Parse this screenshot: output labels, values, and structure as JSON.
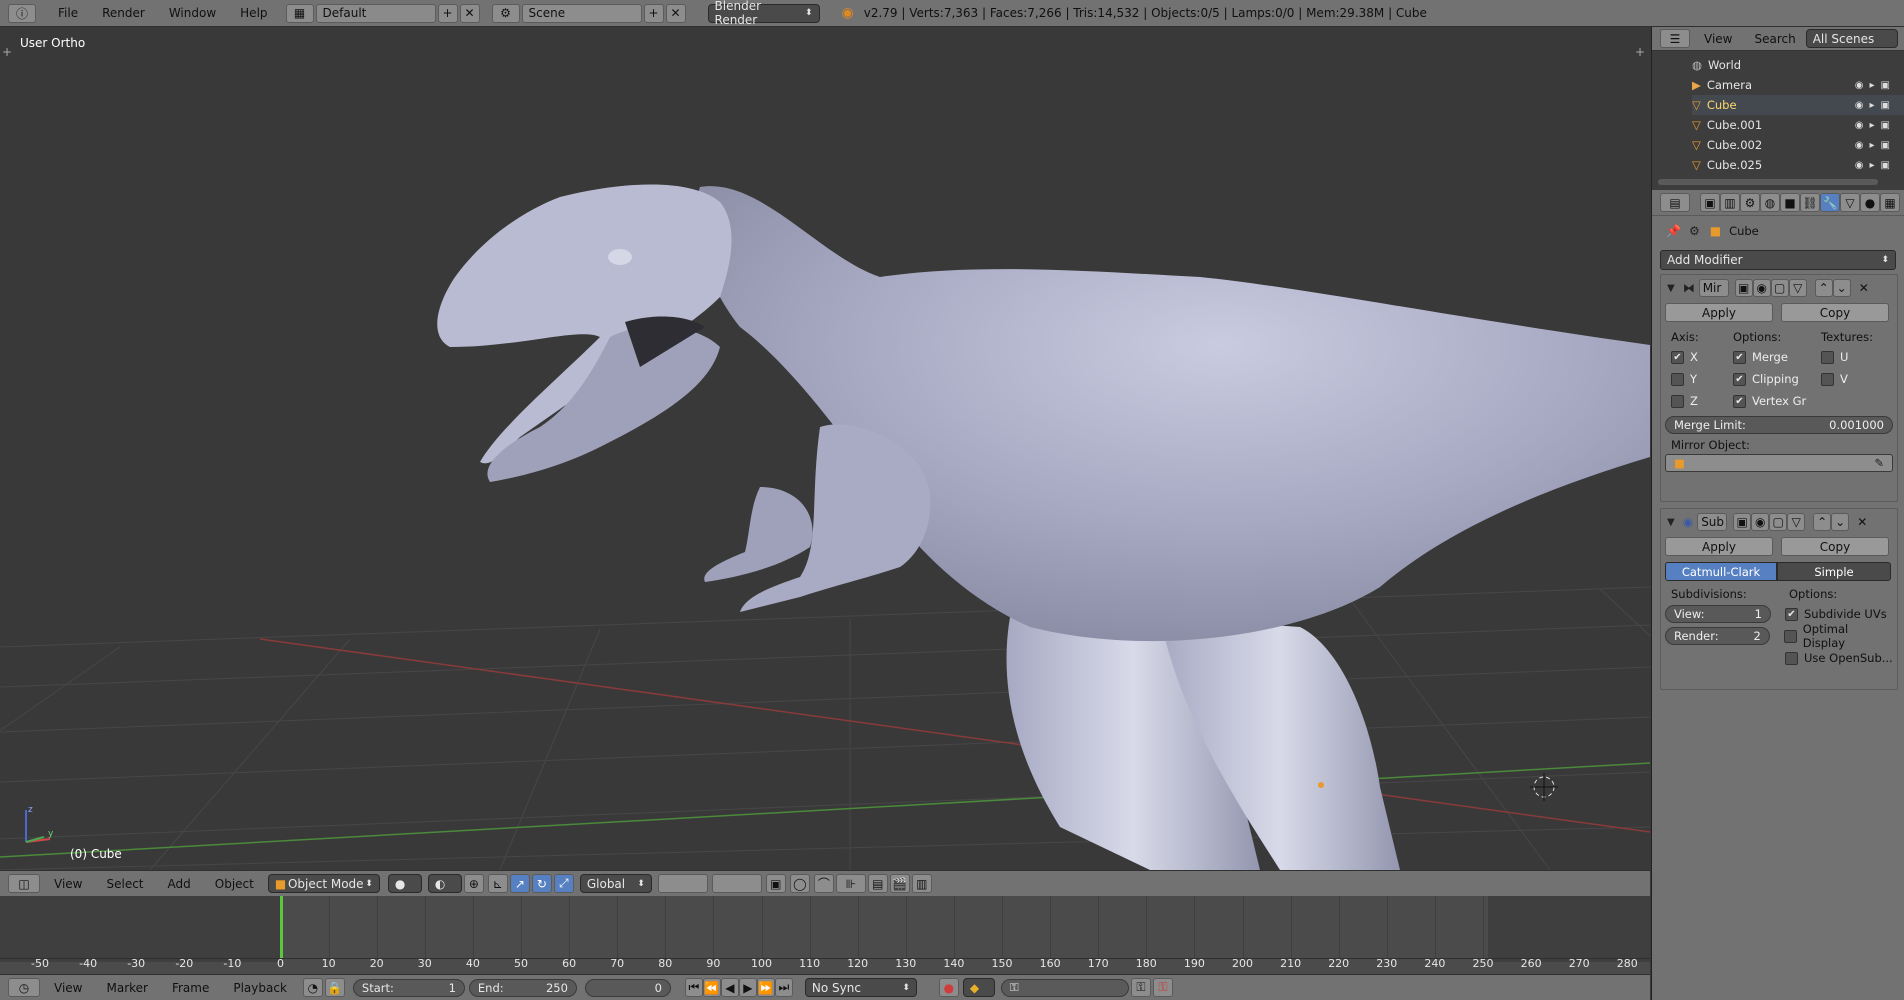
{
  "topbar": {
    "menus": [
      "File",
      "Render",
      "Window",
      "Help"
    ],
    "layout_name": "Default",
    "scene_name": "Scene",
    "render_engine": "Blender Render",
    "stats": "v2.79 | Verts:7,363 | Faces:7,266 | Tris:14,532 | Objects:0/5 | Lamps:0/0 | Mem:29.38M | Cube"
  },
  "viewport": {
    "view_label": "User Ortho",
    "object_label": "(0) Cube",
    "axis_x": "x",
    "axis_y": "y",
    "axis_z": "z"
  },
  "view3d_header": {
    "menus": [
      "View",
      "Select",
      "Add",
      "Object"
    ],
    "mode": "Object Mode",
    "orientation": "Global"
  },
  "timeline": {
    "ticks": [
      "-50",
      "-40",
      "-30",
      "-20",
      "-10",
      "0",
      "10",
      "20",
      "30",
      "40",
      "50",
      "60",
      "70",
      "80",
      "90",
      "100",
      "110",
      "120",
      "130",
      "140",
      "150",
      "160",
      "170",
      "180",
      "190",
      "200",
      "210",
      "220",
      "230",
      "240",
      "250",
      "260",
      "270",
      "280"
    ],
    "current_frame_label": "0",
    "menus": [
      "View",
      "Marker",
      "Frame",
      "Playback"
    ],
    "start_label": "Start:",
    "start_value": "1",
    "end_label": "End:",
    "end_value": "250",
    "frame_value": "0",
    "sync": "No Sync"
  },
  "outliner": {
    "menus": [
      "View",
      "Search"
    ],
    "scope": "All Scenes",
    "items": [
      {
        "name": "World"
      },
      {
        "name": "Camera"
      },
      {
        "name": "Cube"
      },
      {
        "name": "Cube.001"
      },
      {
        "name": "Cube.002"
      },
      {
        "name": "Cube.025"
      }
    ]
  },
  "properties": {
    "context_object": "Cube",
    "add_modifier": "Add Modifier",
    "mirror": {
      "name": "Mir",
      "apply": "Apply",
      "copy": "Copy",
      "axis_label": "Axis:",
      "options_label": "Options:",
      "textures_label": "Textures:",
      "axis": [
        {
          "label": "X",
          "checked": true
        },
        {
          "label": "Y",
          "checked": false
        },
        {
          "label": "Z",
          "checked": false
        }
      ],
      "options": [
        {
          "label": "Merge",
          "checked": true
        },
        {
          "label": "Clipping",
          "checked": true
        },
        {
          "label": "Vertex Gr",
          "checked": true
        }
      ],
      "textures": [
        {
          "label": "U",
          "checked": false
        },
        {
          "label": "V",
          "checked": false
        }
      ],
      "merge_limit_label": "Merge Limit:",
      "merge_limit_value": "0.001000",
      "mirror_object_label": "Mirror Object:"
    },
    "subsurf": {
      "name": "Sub",
      "apply": "Apply",
      "copy": "Copy",
      "type_catmull": "Catmull-Clark",
      "type_simple": "Simple",
      "subdivisions_label": "Subdivisions:",
      "options_label": "Options:",
      "view_label": "View:",
      "view_value": "1",
      "render_label": "Render:",
      "render_value": "2",
      "opt_subdivide_uvs": "Subdivide UVs",
      "opt_optimal_display": "Optimal Display",
      "opt_use_opensubdiv": "Use OpenSub..."
    }
  },
  "colors": {
    "accent_blue": "#5680c2",
    "header_gray": "#727272",
    "viewport_bg": "#393939"
  }
}
